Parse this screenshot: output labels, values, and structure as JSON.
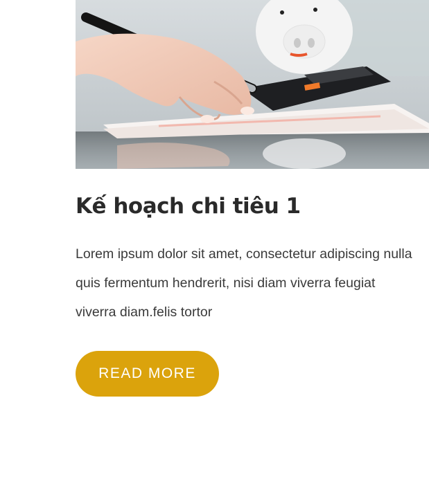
{
  "post": {
    "image_alt": "Hand writing with a pen next to a calculator and a piggy bank",
    "title": "Kế hoạch chi tiêu 1",
    "excerpt_lines": [
      "Lorem ipsum dolor sit amet, consectetur adipiscing nulla",
      "quis fermentum hendrerit, nisi diam viverra feugiat",
      "viverra diam.felis tortor"
    ],
    "read_more_label": "READ MORE"
  },
  "colors": {
    "button_bg": "#dba30c",
    "button_text": "#ffffff",
    "title": "#2a2a2a",
    "body_text": "#3a3a3a"
  }
}
